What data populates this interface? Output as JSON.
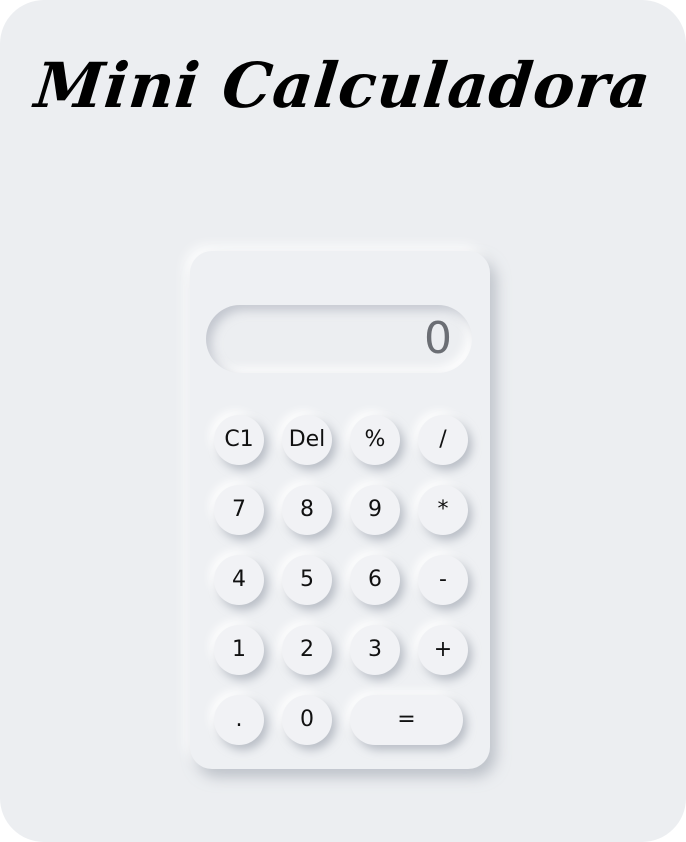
{
  "title": "Mini Calculadora",
  "display": {
    "value": "0"
  },
  "keys": {
    "clear": "C1",
    "delete": "Del",
    "percent": "%",
    "divide": "/",
    "seven": "7",
    "eight": "8",
    "nine": "9",
    "multiply": "*",
    "four": "4",
    "five": "5",
    "six": "6",
    "subtract": "-",
    "one": "1",
    "two": "2",
    "three": "3",
    "add": "+",
    "decimal": ".",
    "zero": "0",
    "equals": "="
  },
  "colors": {
    "background": "#eceef1",
    "panel": "#eef0f3",
    "display_text": "#6b6e74",
    "key_text": "#111111"
  }
}
